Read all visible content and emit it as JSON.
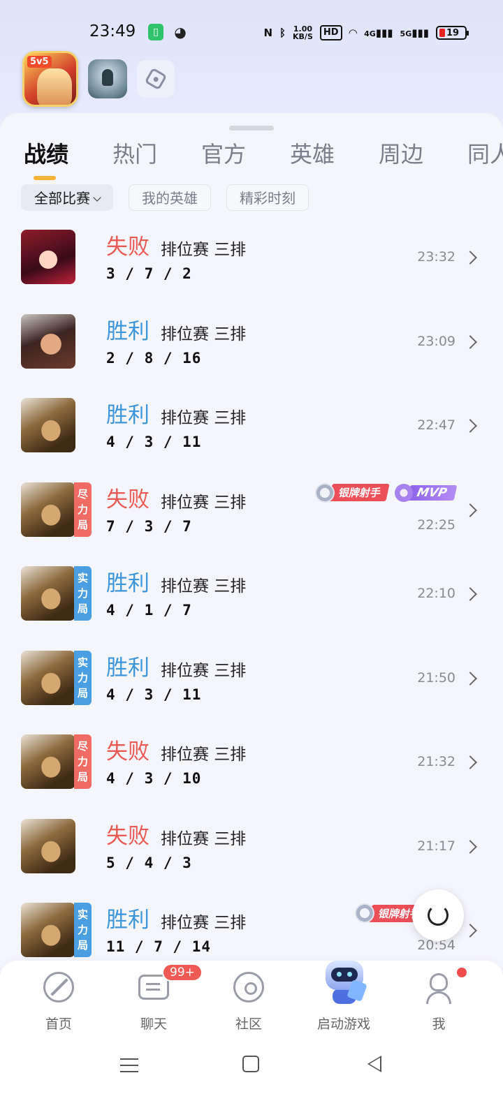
{
  "status_bar": {
    "time": "23:49",
    "net_rate_top": "1.00",
    "net_rate_bottom": "KB/S",
    "hd_label": "HD",
    "sig1": "4G",
    "sig2": "5G",
    "battery": "19"
  },
  "apps": {
    "main_tag": "5v5"
  },
  "tabs": [
    "战绩",
    "热门",
    "官方",
    "英雄",
    "周边",
    "同人"
  ],
  "filters": [
    "全部比赛",
    "我的英雄",
    "精彩时刻"
  ],
  "matches": [
    {
      "result": "失败",
      "outcome": "lose",
      "mode": "排位赛 三排",
      "kda": "3 / 7 / 2",
      "time": "23:32",
      "avatar": "av-1",
      "tag": "",
      "tag_color": ""
    },
    {
      "result": "胜利",
      "outcome": "win",
      "mode": "排位赛 三排",
      "kda": "2 / 8 / 16",
      "time": "23:09",
      "avatar": "av-2",
      "tag": "",
      "tag_color": ""
    },
    {
      "result": "胜利",
      "outcome": "win",
      "mode": "排位赛 三排",
      "kda": "4 / 3 / 11",
      "time": "22:47",
      "avatar": "av-3",
      "tag": "",
      "tag_color": ""
    },
    {
      "result": "失败",
      "outcome": "lose",
      "mode": "排位赛 三排",
      "kda": "7 / 3 / 7",
      "time": "22:25",
      "avatar": "av-3",
      "tag": "尽力局",
      "tag_color": "red",
      "badges": [
        "银牌射手",
        "MVP"
      ]
    },
    {
      "result": "胜利",
      "outcome": "win",
      "mode": "排位赛 三排",
      "kda": "4 / 1 / 7",
      "time": "22:10",
      "avatar": "av-3",
      "tag": "实力局",
      "tag_color": "blue"
    },
    {
      "result": "胜利",
      "outcome": "win",
      "mode": "排位赛 三排",
      "kda": "4 / 3 / 11",
      "time": "21:50",
      "avatar": "av-3",
      "tag": "实力局",
      "tag_color": "blue"
    },
    {
      "result": "失败",
      "outcome": "lose",
      "mode": "排位赛 三排",
      "kda": "4 / 3 / 10",
      "time": "21:32",
      "avatar": "av-3",
      "tag": "尽力局",
      "tag_color": "red"
    },
    {
      "result": "失败",
      "outcome": "lose",
      "mode": "排位赛 三排",
      "kda": "5 / 4 / 3",
      "time": "21:17",
      "avatar": "av-3",
      "tag": "",
      "tag_color": ""
    },
    {
      "result": "胜利",
      "outcome": "win",
      "mode": "排位赛 三排",
      "kda": "11 / 7 / 14",
      "time": "20:54",
      "avatar": "av-3",
      "tag": "实力局",
      "tag_color": "blue",
      "badges": [
        "银牌射手",
        "gold"
      ]
    }
  ],
  "bottom_nav": {
    "home": "首页",
    "chat": "聊天",
    "chat_badge": "99+",
    "community": "社区",
    "launch": "启动游戏",
    "me": "我"
  },
  "colors": {
    "lose": "#ea5a55",
    "win": "#3d95dc",
    "tab_indicator": "#f3b23a"
  }
}
